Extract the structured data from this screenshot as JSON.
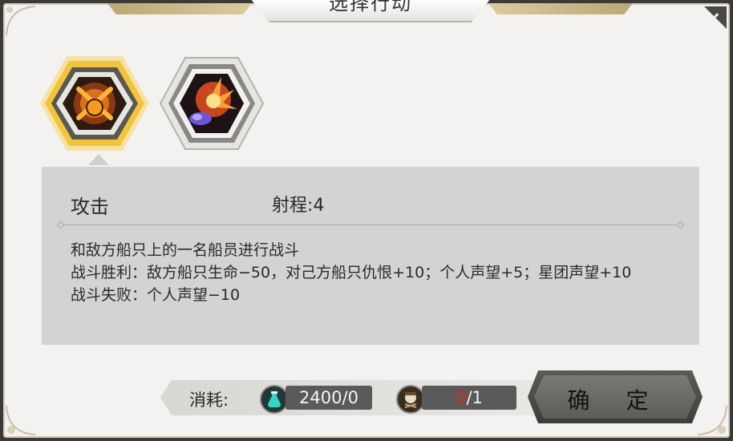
{
  "window": {
    "title": "选择行动"
  },
  "actions": [
    {
      "name": "attack",
      "icon": "crossed-pistols-icon",
      "selected": true
    },
    {
      "name": "explosion",
      "icon": "explosion-icon",
      "selected": false
    }
  ],
  "detail": {
    "name": "攻击",
    "range": "射程:4",
    "lines": [
      "和敌方船只上的一名船员进行战斗",
      "战斗胜利：敌方船只生命−50，对己方船只仇恨+10；个人声望+5；星团声望+10",
      "战斗失败：个人声望−10"
    ]
  },
  "cost": {
    "label": "消耗:",
    "resource1": {
      "icon": "potion-flask-icon",
      "text": "2400/0"
    },
    "resource2": {
      "icon": "pirate-token-icon",
      "current": "0",
      "total": "/1"
    }
  },
  "buttons": {
    "confirm": "确 定"
  },
  "colors": {
    "panel": "#f4f2f1",
    "selected_glow": "#f3c33a",
    "confirm_button": "#5d5c58",
    "alert_red": "#e2241b"
  }
}
